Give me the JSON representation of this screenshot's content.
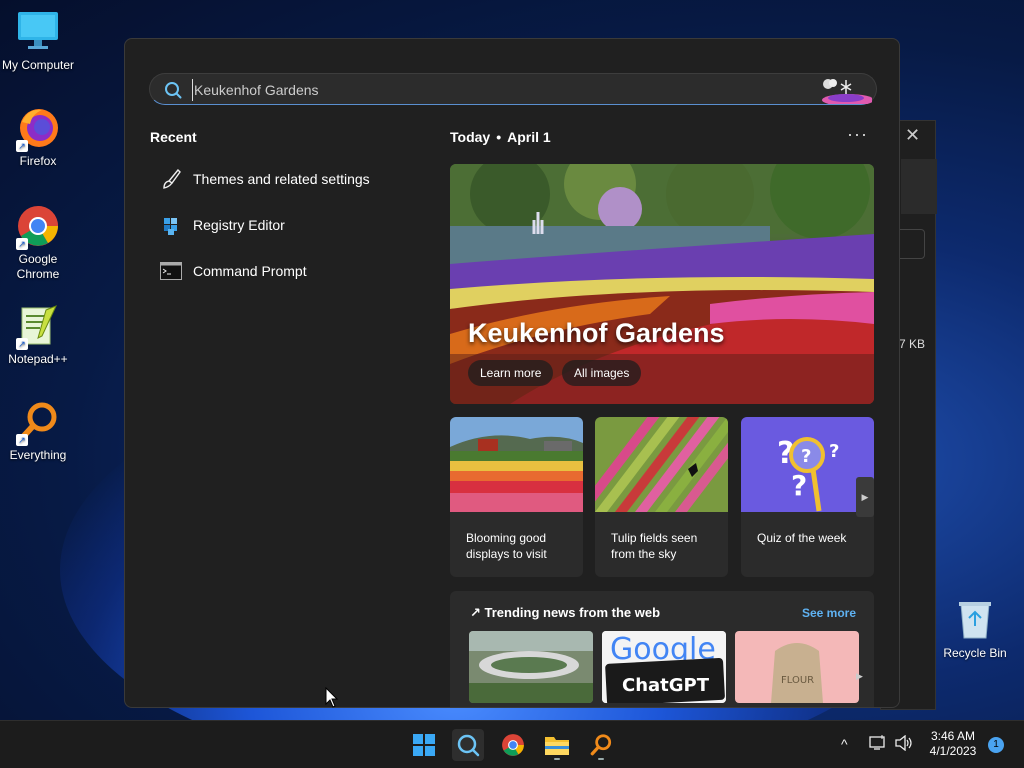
{
  "desktop": {
    "icons": [
      {
        "label": "My Computer",
        "icon": "monitor-icon"
      },
      {
        "label": "Firefox",
        "icon": "firefox-icon"
      },
      {
        "label": "Google Chrome",
        "icon": "chrome-icon"
      },
      {
        "label": "Notepad++",
        "icon": "notepadpp-icon"
      },
      {
        "label": "Everything",
        "icon": "everything-icon"
      },
      {
        "label": "Recycle Bin",
        "icon": "recycle-bin-icon"
      }
    ]
  },
  "background_window": {
    "size_text": "7 KB"
  },
  "search": {
    "query": "Keukenhof Gardens"
  },
  "recent": {
    "title": "Recent",
    "items": [
      {
        "label": "Themes and related settings",
        "icon": "brush-icon"
      },
      {
        "label": "Registry Editor",
        "icon": "registry-icon"
      },
      {
        "label": "Command Prompt",
        "icon": "cmd-icon"
      }
    ]
  },
  "today": {
    "label": "Today",
    "separator": "•",
    "date": "April 1",
    "more": "···"
  },
  "hero": {
    "title": "Keukenhof Gardens",
    "learn_more": "Learn more",
    "all_images": "All images"
  },
  "cards": [
    {
      "caption": "Blooming good displays to visit"
    },
    {
      "caption": "Tulip fields seen from the sky"
    },
    {
      "caption": "Quiz of the week"
    }
  ],
  "trending": {
    "title": "Trending news from the web",
    "see_more": "See more",
    "thumb_texts": [
      "Google",
      "ChatGPT",
      "FLOUR"
    ]
  },
  "taskbar": {
    "apps": [
      "start-icon",
      "search-icon",
      "chrome-icon",
      "file-explorer-icon",
      "everything-icon"
    ],
    "tray_chevron": "^",
    "time": "3:46 AM",
    "date": "4/1/2023",
    "notifications": "1"
  },
  "colors": {
    "accent": "#5fb2f2",
    "panel": "#202020",
    "card": "#2b2b2b"
  }
}
